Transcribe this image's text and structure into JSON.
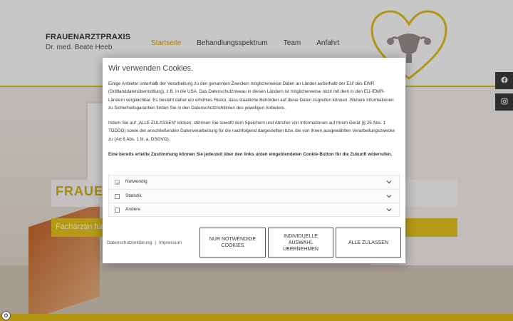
{
  "site": {
    "brand_title": "FRAUENARZTPRAXIS",
    "brand_sub": "Dr. med. Beate Heeb",
    "nav": [
      "Startseite",
      "Behandlungsspektrum",
      "Team",
      "Anfahrt"
    ],
    "hero_title": "FRAUEN",
    "hero_sub": "Fachärztin für"
  },
  "cookie": {
    "title": "Wir verwenden Cookies.",
    "text1": "Einige Anbieter unterhalb der Verarbeitung zu den genannten Zwecken möglicherweise Daten an Länder außerhalb der EU/ des EWR (Drittlanddatenübermittlung), z.B. in die USA. Das Datenschutzniveau in diesen Ländern ist möglicherweise nicht mit dem in den EU-/EWR-Ländern vergleichbar. Es besteht daher ein erhöhtes Risiko, dass staatliche Behörden auf diese Daten zugreifen können. Weitere Informationen zu Sicherheitsgarantien finden Sie in den Datenschutzrichtlinien des jeweiligen Anbieters.",
    "text2": "Indem Sie auf „ALLE ZULASSEN\" klicken, stimmen Sie sowohl dem Speichern und Abrufen von Informationen auf Ihrem Gerät (§ 25 Abs. 1 TDDDG) sowie der anschließenden Datenverarbeitung für die nachfolgend dargestellten bzw. die von Ihnen ausgewählten Verarbeitungszwecke zu (Art 6 Abs. 1 lit. a. DSGVO).",
    "text3": "Eine bereits erteilte Zustimmung können Sie jederzeit über den links unten eingeblendeten Cookie-Button für die Zukunft widerrufen.",
    "categories": [
      {
        "label": "Notwendig",
        "checked": true,
        "disabled": true
      },
      {
        "label": "Statistik",
        "checked": false,
        "disabled": false
      },
      {
        "label": "Andere",
        "checked": false,
        "disabled": false
      }
    ],
    "privacy_link": "Datenschutzerklärung",
    "separator": "|",
    "imprint_link": "Impressum",
    "btn_necessary": "NUR NOTWENDIGE COOKIES",
    "btn_individual": "INDIVIDUELLE AUSWAHL ÜBERNEHMEN",
    "btn_all": "ALLE ZULASSEN"
  },
  "icons": {
    "facebook": "facebook-icon",
    "instagram": "instagram-icon",
    "cookie_settings": "cookie-settings-icon"
  },
  "colors": {
    "accent": "#e6c21a",
    "nav_active": "#d4a70a"
  }
}
